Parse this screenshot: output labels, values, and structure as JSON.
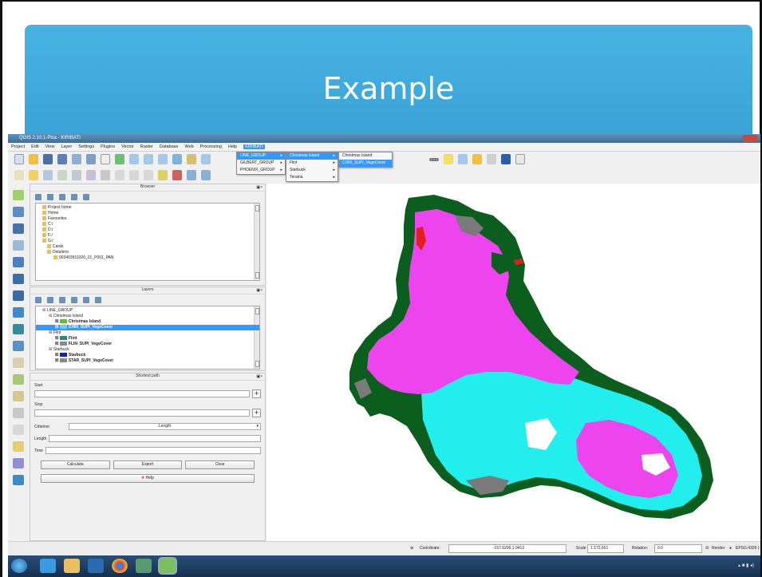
{
  "slide": {
    "title": "Example"
  },
  "window": {
    "title": "QGIS 2.10.1-Pisa - KIRIBATI"
  },
  "menu": [
    "Project",
    "Edit",
    "View",
    "Layer",
    "Settings",
    "Plugins",
    "Vector",
    "Raster",
    "Database",
    "Web",
    "Processing",
    "Help",
    "KIRIBATI"
  ],
  "dropdown1": [
    "LINE_GROUP",
    "GILBERT_GROUP",
    "PHOENIX_GROUP"
  ],
  "dropdown2": [
    "Christmas Island",
    "Flint",
    "Starbuck",
    "Teraina"
  ],
  "dropdown3": [
    "Christmas Island",
    "CHRI_SUPI_VegeCover"
  ],
  "browser": {
    "title": "Browser",
    "items": [
      "Project home",
      "Home",
      "Favourites",
      "C:/",
      "D:/",
      "F:/",
      "G:/",
      "Cards",
      "Detaliero",
      "003403911020_01_P001_PAN"
    ]
  },
  "layers": {
    "title": "Layers",
    "items": [
      {
        "label": "LINE_GROUP",
        "indent": 1,
        "swatch": "",
        "bold": false,
        "sel": false
      },
      {
        "label": "Christmas Island",
        "indent": 2,
        "swatch": "",
        "bold": false,
        "sel": false
      },
      {
        "label": "Christmas Island",
        "indent": 3,
        "swatch": "#66bb33",
        "bold": true,
        "sel": false
      },
      {
        "label": "CHRI_SUPI_VegeCover",
        "indent": 3,
        "swatch": "#66d3ff",
        "bold": true,
        "sel": true
      },
      {
        "label": "Flint",
        "indent": 2,
        "swatch": "",
        "bold": false,
        "sel": false
      },
      {
        "label": "Flint",
        "indent": 3,
        "swatch": "#1e8a8a",
        "bold": true,
        "sel": false
      },
      {
        "label": "FLIN_SUPI_VegeCover",
        "indent": 3,
        "swatch": "#888888",
        "bold": true,
        "sel": false
      },
      {
        "label": "Starbuck",
        "indent": 2,
        "swatch": "",
        "bold": false,
        "sel": false
      },
      {
        "label": "Starbuck",
        "indent": 3,
        "swatch": "#1b1bb8",
        "bold": true,
        "sel": false
      },
      {
        "label": "STAR_SUPI_VegeCover",
        "indent": 3,
        "swatch": "#888888",
        "bold": true,
        "sel": false
      }
    ]
  },
  "shortest_path": {
    "title": "Shortest path",
    "start_label": "Start",
    "stop_label": "Stop",
    "criterion_label": "Criterion",
    "criterion_value": "Length",
    "length_label": "Length",
    "time_label": "Time",
    "calculate": "Calculate",
    "export": "Export",
    "clear": "Clear",
    "help": "Help"
  },
  "status": {
    "coordinate_label": "Coordinate:",
    "coordinate_value": "-157.6299,1.9413",
    "scale_label": "Scale",
    "scale_value": "1:172,651",
    "rotation_label": "Rotation:",
    "rotation_value": "0.0",
    "render_label": "Render",
    "crs": "EPSG:4326 (OTF)"
  },
  "colors": {
    "banner": "#3aa3d6",
    "lagoon": "#ee44ee",
    "cyan": "#22eeee",
    "forest": "#0b5e1e",
    "gray": "#7a7a7a",
    "selection": "#3399ff"
  }
}
